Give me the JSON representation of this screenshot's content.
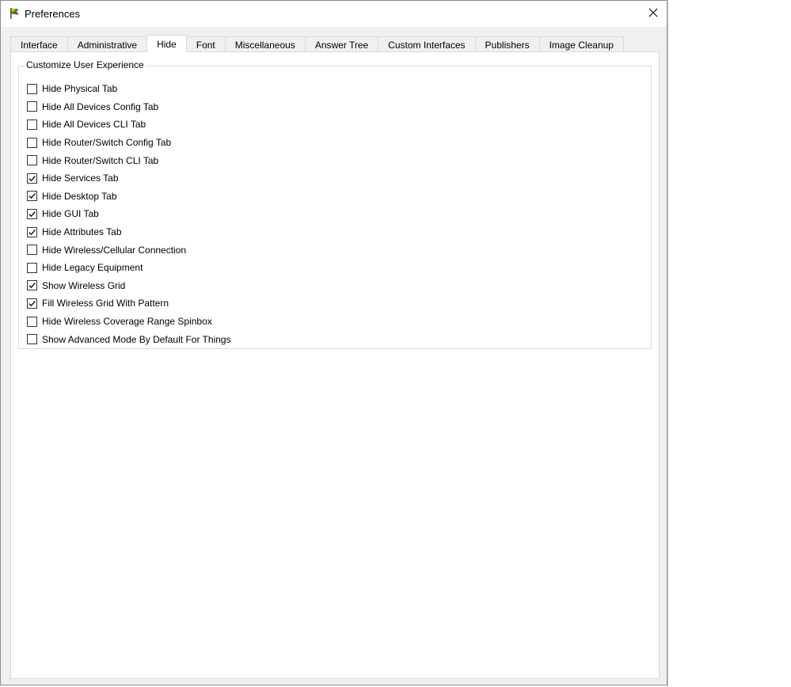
{
  "window": {
    "title": "Preferences",
    "app_icon": "packet-tracer-flag-icon",
    "close_icon": "close-icon"
  },
  "tabs": [
    {
      "label": "Interface",
      "active": false
    },
    {
      "label": "Administrative",
      "active": false
    },
    {
      "label": "Hide",
      "active": true
    },
    {
      "label": "Font",
      "active": false
    },
    {
      "label": "Miscellaneous",
      "active": false
    },
    {
      "label": "Answer Tree",
      "active": false
    },
    {
      "label": "Custom Interfaces",
      "active": false
    },
    {
      "label": "Publishers",
      "active": false
    },
    {
      "label": "Image Cleanup",
      "active": false
    }
  ],
  "group": {
    "title": "Customize User Experience",
    "options": [
      {
        "label": "Hide Physical Tab",
        "checked": false
      },
      {
        "label": "Hide All Devices Config Tab",
        "checked": false
      },
      {
        "label": "Hide All Devices CLI Tab",
        "checked": false
      },
      {
        "label": "Hide Router/Switch Config Tab",
        "checked": false
      },
      {
        "label": "Hide Router/Switch CLI Tab",
        "checked": false
      },
      {
        "label": "Hide Services Tab",
        "checked": true
      },
      {
        "label": "Hide Desktop Tab",
        "checked": true
      },
      {
        "label": "Hide GUI Tab",
        "checked": true
      },
      {
        "label": "Hide Attributes Tab",
        "checked": true
      },
      {
        "label": "Hide Wireless/Cellular Connection",
        "checked": false
      },
      {
        "label": "Hide Legacy Equipment",
        "checked": false
      },
      {
        "label": "Show Wireless Grid",
        "checked": true
      },
      {
        "label": "Fill Wireless Grid With Pattern",
        "checked": true
      },
      {
        "label": "Hide Wireless Coverage Range Spinbox",
        "checked": false
      },
      {
        "label": "Show Advanced Mode By Default For Things",
        "checked": false
      }
    ]
  },
  "colors": {
    "window_bg": "#f0f0f0",
    "pane_bg": "#ffffff",
    "border": "#d9d9d9"
  }
}
